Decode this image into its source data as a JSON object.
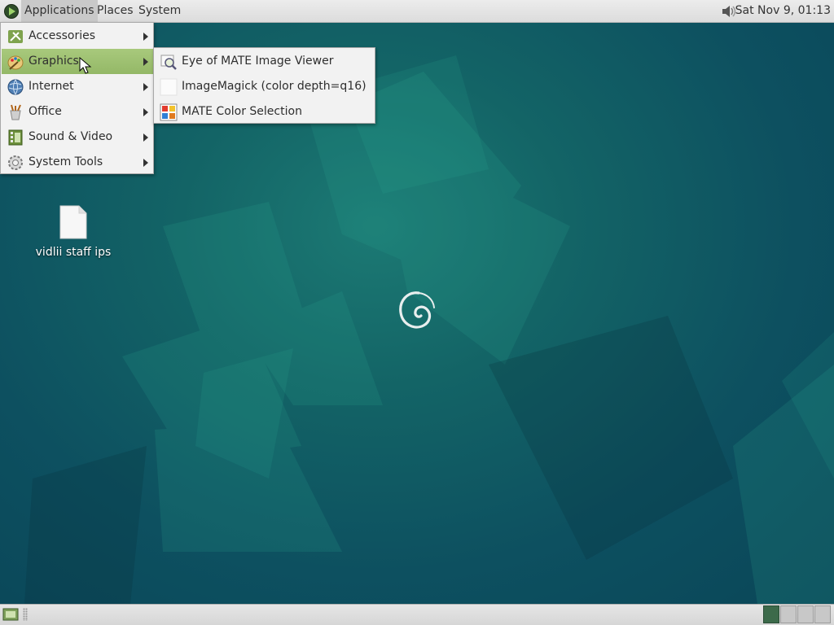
{
  "top_panel": {
    "menus": [
      "Applications",
      "Places",
      "System"
    ],
    "clock": "Sat Nov 9, 01:13"
  },
  "applications_menu": {
    "items": [
      {
        "label": "Accessories",
        "icon": "accessories-icon"
      },
      {
        "label": "Graphics",
        "icon": "graphics-icon"
      },
      {
        "label": "Internet",
        "icon": "internet-globe-icon"
      },
      {
        "label": "Office",
        "icon": "office-icon"
      },
      {
        "label": "Sound & Video",
        "icon": "sound-video-icon"
      },
      {
        "label": "System Tools",
        "icon": "system-tools-icon"
      }
    ]
  },
  "graphics_submenu": {
    "items": [
      {
        "label": "Eye of MATE Image Viewer",
        "icon": "image-viewer-icon"
      },
      {
        "label": "ImageMagick (color depth=q16)",
        "icon": "imagemagick-icon"
      },
      {
        "label": "MATE Color Selection",
        "icon": "color-selection-icon"
      }
    ]
  },
  "desktop": {
    "file_label": "vidlii staff ips"
  },
  "colors": {
    "highlight": "#9cc070",
    "desktop_bg": "#0f5560"
  }
}
